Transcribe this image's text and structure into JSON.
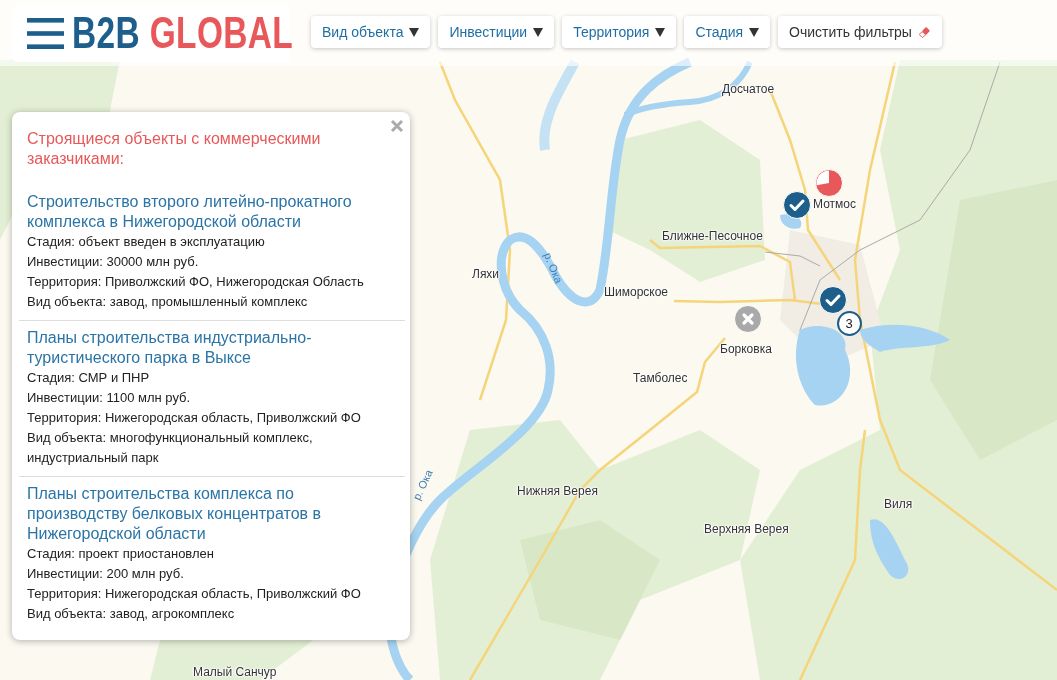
{
  "header": {
    "logo": {
      "primary": "B2B",
      "secondary": "GLOBAL"
    },
    "filters": [
      {
        "label": "Вид объекта",
        "kind": "dropdown"
      },
      {
        "label": "Инвестиции",
        "kind": "dropdown"
      },
      {
        "label": "Территория",
        "kind": "dropdown"
      },
      {
        "label": "Стадия",
        "kind": "dropdown"
      },
      {
        "label": "Очистить фильтры",
        "kind": "clear"
      }
    ]
  },
  "popup": {
    "heading": "Строящиеся объекты с коммерческими заказчиками:",
    "projects": [
      {
        "title": "Строительство второго литейно-прокатного комплекса в Нижегородской области",
        "details": [
          "Стадия: объект введен в эксплуатацию",
          "Инвестиции: 30000 млн руб.",
          "Территория: Приволжский ФО, Нижегородская Область",
          "Вид объекта: завод, промышленный комплекс"
        ]
      },
      {
        "title": "Планы строительства индустриально-туристического парка в Выксе",
        "details": [
          "Стадия: СМР и ПНР",
          "Инвестиции: 1100 млн руб.",
          "Территория: Нижегородская область, Приволжский ФО",
          "Вид объекта: многофункциональный комплекс, индустриальный парк"
        ]
      },
      {
        "title": "Планы строительства комплекса по производству белковых концентратов в Нижегородской области",
        "details": [
          "Стадия: проект приостановлен",
          "Инвестиции: 200 млн руб.",
          "Территория: Нижегородская область, Приволжский ФО",
          "Вид объекта: завод, агрокомплекс"
        ]
      }
    ]
  },
  "map": {
    "places": [
      "Досчатое",
      "Мотмос",
      "Ближне-Песочное",
      "Ляхи",
      "Шиморское",
      "Борковка",
      "Тамболес",
      "Нижняя Верея",
      "Виля",
      "Верхняя Верея",
      "Малый Санчур"
    ],
    "river_labels": [
      "р. Ока",
      "р. Ока"
    ],
    "markers": [
      {
        "kind": "pie"
      },
      {
        "kind": "check"
      },
      {
        "kind": "check"
      },
      {
        "kind": "cross"
      },
      {
        "kind": "cluster",
        "count": "3"
      }
    ]
  }
}
